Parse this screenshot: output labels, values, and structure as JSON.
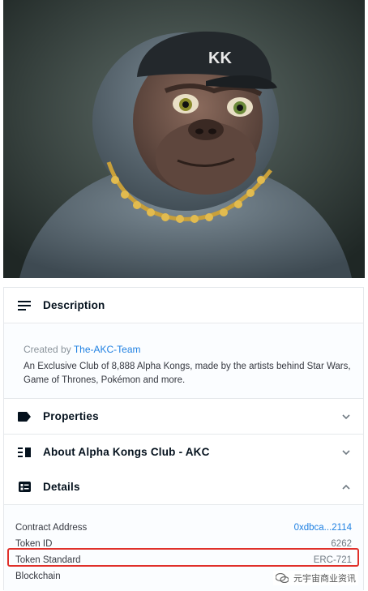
{
  "hero": {
    "cap_text": "KK",
    "alt": "Alpha Kong"
  },
  "description": {
    "title": "Description",
    "created_prefix": "Created by ",
    "creator": "The-AKC-Team",
    "text": "An Exclusive Club of 8,888 Alpha Kongs, made by the artists behind Star Wars, Game of Thrones, Pokémon and more."
  },
  "properties": {
    "title": "Properties"
  },
  "about": {
    "title": "About Alpha Kongs Club - AKC"
  },
  "details": {
    "title": "Details",
    "rows": [
      {
        "label": "Contract Address",
        "value": "0xdbca...2114"
      },
      {
        "label": "Token ID",
        "value": "6262"
      },
      {
        "label": "Token Standard",
        "value": "ERC-721"
      },
      {
        "label": "Blockchain",
        "value": ""
      }
    ]
  },
  "watermark": {
    "text": "元宇宙商业资讯"
  },
  "colors": {
    "link": "#2081e2",
    "highlight": "#e0302a",
    "border": "#e5e8eb"
  }
}
